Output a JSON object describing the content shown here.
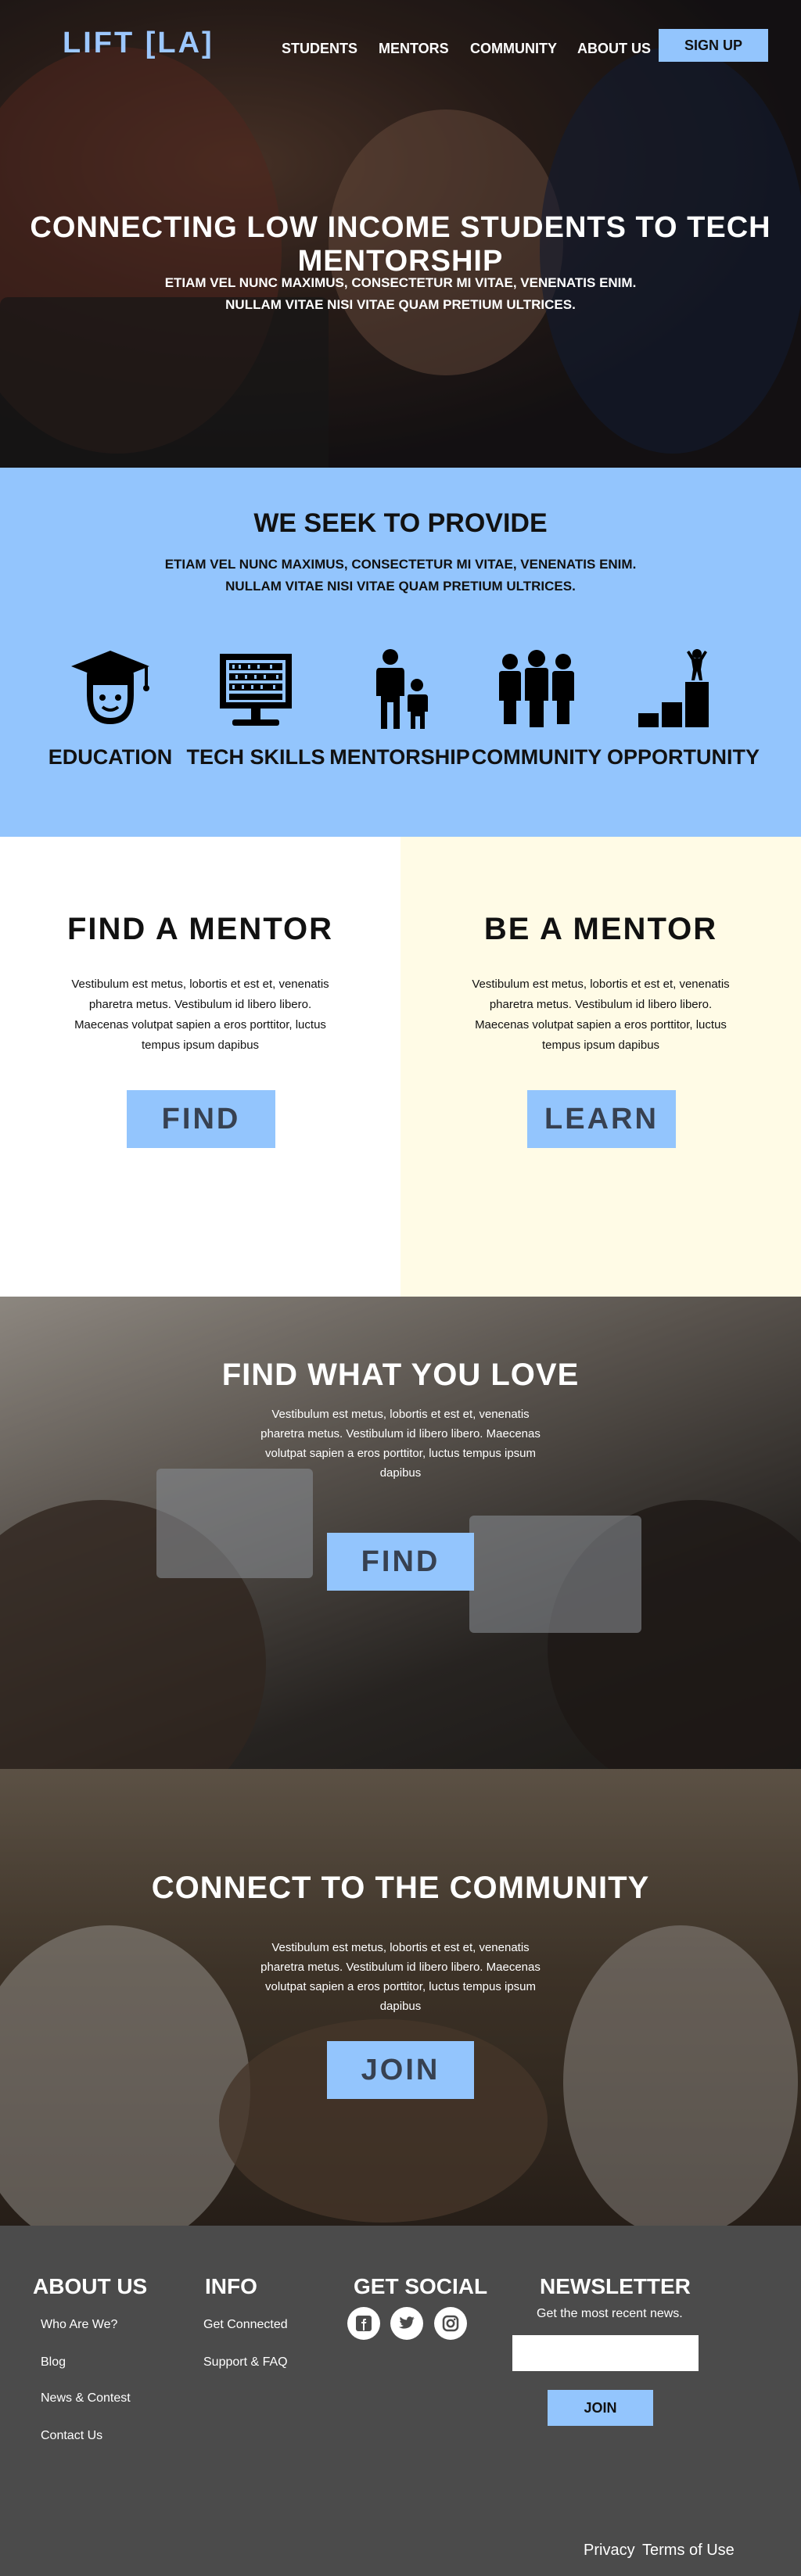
{
  "nav": {
    "logo": "LIFT [LA]",
    "items": [
      "STUDENTS",
      "MENTORS",
      "COMMUNITY",
      "ABOUT US"
    ],
    "signup": "SIGN UP"
  },
  "hero": {
    "title": "CONNECTING LOW INCOME STUDENTS TO TECH MENTORSHIP",
    "sub_line1": "ETIAM VEL NUNC MAXIMUS, CONSECTETUR MI VITAE, VENENATIS ENIM.",
    "sub_line2": "NULLAM VITAE NISI VITAE QUAM PRETIUM ULTRICES."
  },
  "provide": {
    "title": "WE SEEK TO PROVIDE",
    "sub_line1": "ETIAM VEL NUNC MAXIMUS, CONSECTETUR MI VITAE, VENENATIS ENIM.",
    "sub_line2": "NULLAM VITAE NISI VITAE QUAM PRETIUM ULTRICES.",
    "features": [
      {
        "label": "EDUCATION",
        "icon": "graduate-icon"
      },
      {
        "label": "TECH SKILLS",
        "icon": "computer-binary-icon"
      },
      {
        "label": "MENTORSHIP",
        "icon": "adult-child-icon"
      },
      {
        "label": "COMMUNITY",
        "icon": "group-icon"
      },
      {
        "label": "OPPORTUNITY",
        "icon": "podium-climb-icon"
      }
    ]
  },
  "find_mentor": {
    "title": "FIND A MENTOR",
    "text": "Vestibulum est metus, lobortis et est et, venenatis pharetra metus. Vestibulum id libero libero. Maecenas volutpat sapien a eros porttitor, luctus tempus ipsum dapibus",
    "button": "FIND"
  },
  "be_mentor": {
    "title": "BE A MENTOR",
    "text": "Vestibulum est metus, lobortis et est et, venenatis pharetra metus. Vestibulum id libero libero. Maecenas volutpat sapien a eros porttitor, luctus tempus ipsum dapibus",
    "button": "LEARN"
  },
  "find_love": {
    "title": "FIND WHAT YOU LOVE",
    "text": "Vestibulum est metus, lobortis et est et, venenatis pharetra metus. Vestibulum id libero libero. Maecenas volutpat sapien a eros porttitor, luctus tempus ipsum dapibus",
    "button": "FIND"
  },
  "community": {
    "title": "CONNECT TO THE COMMUNITY",
    "text": "Vestibulum est metus, lobortis et est et, venenatis pharetra metus. Vestibulum id libero libero. Maecenas volutpat sapien a eros porttitor, luctus tempus ipsum dapibus",
    "button": "JOIN"
  },
  "footer": {
    "about_title": "ABOUT US",
    "about_links": [
      "Who Are We?",
      "Blog",
      "News & Contest",
      "Contact Us"
    ],
    "info_title": "INFO",
    "info_links": [
      "Get Connected",
      "Support & FAQ"
    ],
    "social_title": "GET SOCIAL",
    "social_icons": [
      "facebook-icon",
      "twitter-icon",
      "instagram-icon"
    ],
    "newsletter_title": "NEWSLETTER",
    "newsletter_text": "Get the most recent news.",
    "newsletter_button": "JOIN",
    "bottom_links": [
      "Privacy",
      "Terms of Use"
    ]
  },
  "colors": {
    "accent": "#93c5fd",
    "cream": "#fffbe6",
    "footer": "#4b4b4b"
  }
}
